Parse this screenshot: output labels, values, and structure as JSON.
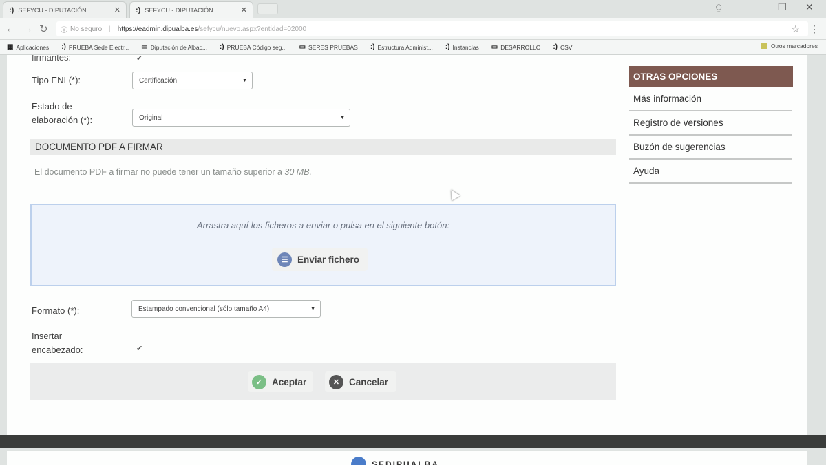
{
  "browser": {
    "tabs": [
      {
        "favicon": ":)",
        "title": "SEFYCU - DIPUTACIÓN ..."
      },
      {
        "favicon": ":)",
        "title": "SEFYCU - DIPUTACIÓN ..."
      }
    ],
    "tab_close": "✕",
    "address": {
      "security_label": "No seguro",
      "host": "https://eadmin.dipualba.es",
      "path": "/sefycu/nuevo.aspx?entidad=02000"
    },
    "bookmarks": [
      {
        "favicon": "▦",
        "label": "Aplicaciones"
      },
      {
        "favicon": ":)",
        "label": "PRUEBA Sede Electr..."
      },
      {
        "favicon": "▭",
        "label": "Diputación de Albac..."
      },
      {
        "favicon": ":)",
        "label": "PRUEBA Código seg..."
      },
      {
        "favicon": "▭",
        "label": "SERES PRUEBAS"
      },
      {
        "favicon": ":)",
        "label": "Estructura Administ..."
      },
      {
        "favicon": ":)",
        "label": "Instancias"
      },
      {
        "favicon": "▭",
        "label": "DESARROLLO"
      },
      {
        "favicon": ":)",
        "label": "CSV"
      }
    ],
    "bookmarks_other": "Otros marcadores"
  },
  "form": {
    "truncated_label": "firmantes:",
    "tipo_eni": {
      "label": "Tipo ENI (*):",
      "value": "Certificación"
    },
    "estado": {
      "label_line1": "Estado de",
      "label_line2": "elaboración (*):",
      "value": "Original"
    },
    "section_title": "DOCUMENTO PDF A FIRMAR",
    "notice_text": "El documento PDF a firmar no puede tener un tamaño superior a ",
    "notice_size": "30 MB.",
    "dropzone_hint": "Arrastra aquí los ficheros a enviar o pulsa en el siguiente botón:",
    "upload_button": "Enviar fichero",
    "formato": {
      "label": "Formato (*):",
      "value": "Estampado convencional (sólo tamaño A4)"
    },
    "insertar": {
      "label_line1": "Insertar",
      "label_line2": "encabezado:"
    },
    "accept_button": "Aceptar",
    "cancel_button": "Cancelar"
  },
  "sidebar": {
    "title": "OTRAS OPCIONES",
    "items": [
      "Más información",
      "Registro de versiones",
      "Buzón de sugerencias",
      "Ayuda"
    ]
  },
  "footer": {
    "brand": "SEDIPUALBA"
  },
  "colors": {
    "sidebar_header": "#7e5950",
    "dropzone_bg": "#eef3fb",
    "dropzone_border": "#bcd0ec",
    "accept_icon": "#7bbf86",
    "cancel_icon": "#555555",
    "upload_icon": "#6e86b8"
  }
}
